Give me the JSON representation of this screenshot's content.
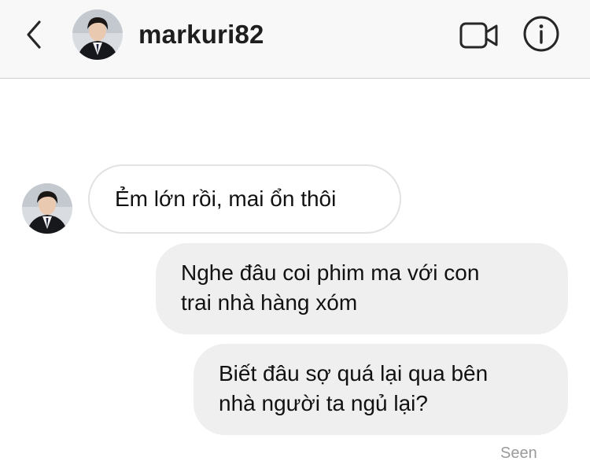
{
  "header": {
    "back_icon": "chevron-left-icon",
    "username": "markuri82",
    "video_icon": "video-camera-icon",
    "info_icon": "info-icon"
  },
  "messages": [
    {
      "direction": "incoming",
      "text": "Ẻm lớn rồi, mai ổn thôi"
    },
    {
      "direction": "outgoing",
      "text": "Nghe đâu coi phim ma với con\ntrai nhà hàng xóm"
    },
    {
      "direction": "outgoing",
      "text": "Biết đâu sợ quá lại qua bên\nnhà người ta ngủ lại?"
    }
  ],
  "status": {
    "seen": "Seen"
  },
  "colors": {
    "header_bg": "#f8f8f8",
    "outgoing_bubble": "#efefef",
    "incoming_border": "#e2e2e2",
    "seen_text": "#9a9a9a"
  }
}
